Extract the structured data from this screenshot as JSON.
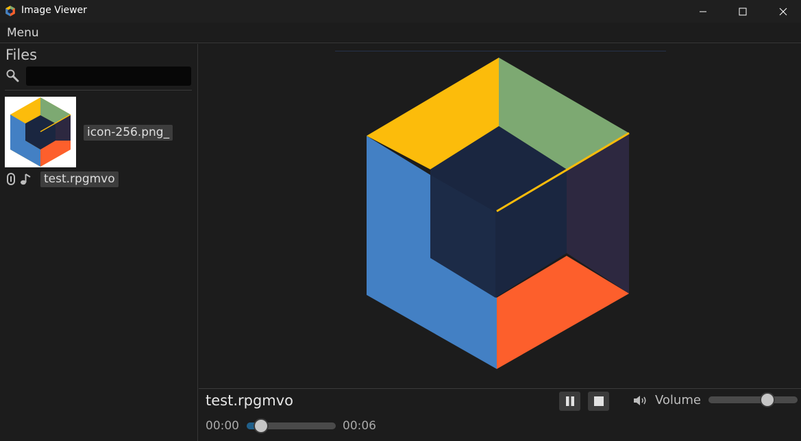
{
  "window": {
    "title": "Image Viewer",
    "app_icon": "cube-logo-icon",
    "controls": [
      "minimize-icon",
      "maximize-icon",
      "close-icon"
    ]
  },
  "menubar": {
    "menu_label": "Menu"
  },
  "sidebar": {
    "heading": "Files",
    "search": {
      "icon": "search-icon",
      "value": "",
      "placeholder": ""
    },
    "files": [
      {
        "name": "icon-256.png_",
        "type": "image",
        "thumbnail": "cube-logo"
      },
      {
        "name": "test.rpgmvo",
        "type": "audio",
        "icons": [
          "attachment-icon",
          "music-note-icon"
        ]
      }
    ]
  },
  "viewer": {
    "image": "cube-logo"
  },
  "controls": {
    "media_title": "test.rpgmvo",
    "pause_icon": "pause-icon",
    "stop_icon": "stop-icon",
    "volume_icon": "speaker-icon",
    "volume_label": "Volume",
    "volume_level": 0.66,
    "current_time": "00:00",
    "total_time": "00:06",
    "progress": 0.16
  },
  "colors": {
    "cube_yellow": "#fcbc0b",
    "cube_green": "#7da972",
    "cube_blue": "#4380c4",
    "cube_orange": "#fd5f2c",
    "cube_inner": "#1a2640",
    "cube_inner_right": "#2d2840",
    "seek_fill": "#1f5f8a",
    "background": "#1c1c1c"
  }
}
